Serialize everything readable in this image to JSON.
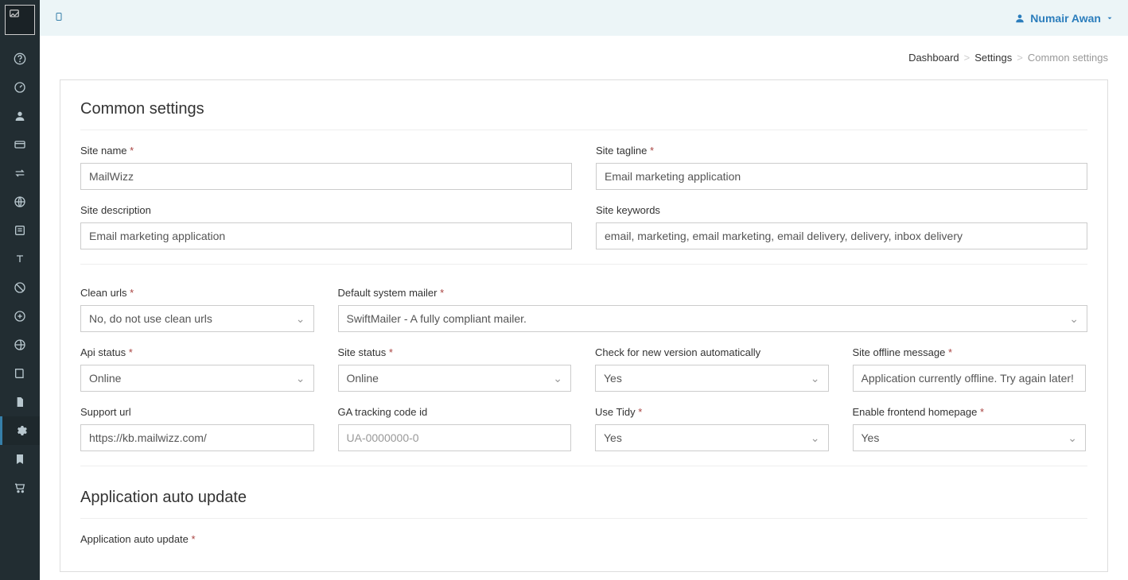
{
  "user": {
    "name": "Numair Awan"
  },
  "breadcrumb": {
    "dashboard": "Dashboard",
    "settings": "Settings",
    "current": "Common settings"
  },
  "sections": {
    "common": {
      "title": "Common settings"
    },
    "auto_update": {
      "title": "Application auto update",
      "label": "Application auto update"
    }
  },
  "fields": {
    "site_name": {
      "label": "Site name",
      "value": "MailWizz"
    },
    "site_tagline": {
      "label": "Site tagline",
      "value": "Email marketing application"
    },
    "site_description": {
      "label": "Site description",
      "value": "Email marketing application"
    },
    "site_keywords": {
      "label": "Site keywords",
      "value": "email, marketing, email marketing, email delivery, delivery, inbox delivery"
    },
    "clean_urls": {
      "label": "Clean urls",
      "value": "No, do not use clean urls"
    },
    "default_mailer": {
      "label": "Default system mailer",
      "value": "SwiftMailer - A fully compliant mailer."
    },
    "api_status": {
      "label": "Api status",
      "value": "Online"
    },
    "site_status": {
      "label": "Site status",
      "value": "Online"
    },
    "check_version": {
      "label": "Check for new version automatically",
      "value": "Yes"
    },
    "offline_msg": {
      "label": "Site offline message",
      "value": "Application currently offline. Try again later!"
    },
    "support_url": {
      "label": "Support url",
      "value": "https://kb.mailwizz.com/"
    },
    "ga_tracking": {
      "label": "GA tracking code id",
      "placeholder": "UA-0000000-0"
    },
    "use_tidy": {
      "label": "Use Tidy",
      "value": "Yes"
    },
    "frontend_home": {
      "label": "Enable frontend homepage",
      "value": "Yes"
    }
  },
  "sidebar_icons": [
    "question-icon",
    "dashboard-icon",
    "user-icon",
    "card-icon",
    "transfer-icon",
    "globe-icon",
    "list-icon",
    "text-icon",
    "block-icon",
    "plus-icon",
    "globe2-icon",
    "book-icon",
    "file-icon",
    "gear-icon",
    "bookmark-icon",
    "cart-icon"
  ]
}
